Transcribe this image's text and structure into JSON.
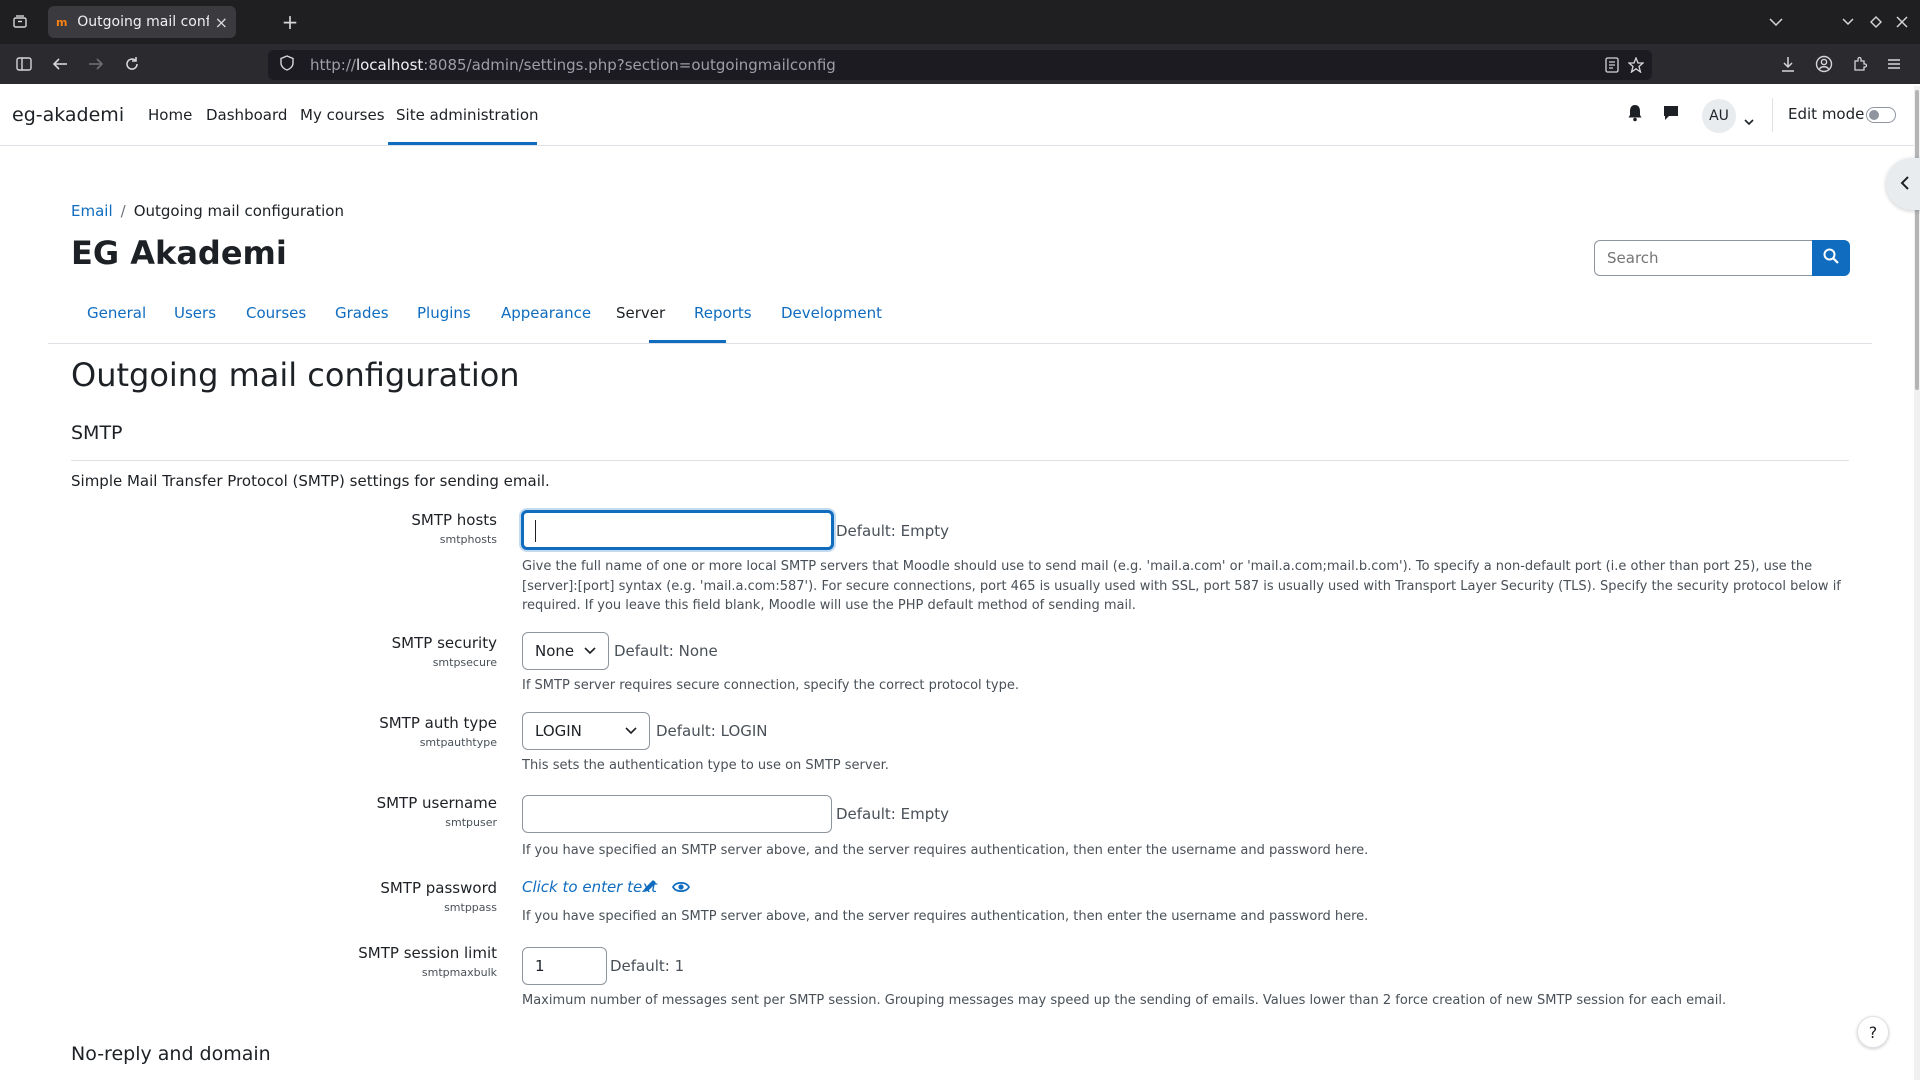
{
  "browser": {
    "tab_title": "Outgoing mail configuration",
    "tab_favicon": "m",
    "url_prefix": "http://",
    "url_host": "localhost",
    "url_rest": ":8085/admin/settings.php?section=outgoingmailconfig"
  },
  "navbar": {
    "brand": "eg-akademi",
    "links": [
      "Home",
      "Dashboard",
      "My courses",
      "Site administration"
    ],
    "active_link": "Site administration",
    "avatar_initials": "AU",
    "edit_mode_label": "Edit mode",
    "edit_mode_on": false
  },
  "breadcrumb": {
    "items": [
      "Email",
      "Outgoing mail configuration"
    ]
  },
  "site_title": "EG Akademi",
  "search": {
    "placeholder": "Search"
  },
  "admin_tabs": {
    "items": [
      "General",
      "Users",
      "Courses",
      "Grades",
      "Plugins",
      "Appearance",
      "Server",
      "Reports",
      "Development"
    ],
    "active": "Server"
  },
  "page": {
    "heading": "Outgoing mail configuration",
    "section_heading": "SMTP",
    "section_desc": "Simple Mail Transfer Protocol (SMTP) settings for sending email.",
    "next_section": "No-reply and domain"
  },
  "settings": {
    "smtphosts": {
      "label": "SMTP hosts",
      "name": "smtphosts",
      "value": "",
      "default": "Default: Empty",
      "help": "Give the full name of one or more local SMTP servers that Moodle should use to send mail (e.g. 'mail.a.com' or 'mail.a.com;mail.b.com'). To specify a non-default port (i.e other than port 25), use the [server]:[port] syntax (e.g. 'mail.a.com:587'). For secure connections, port 465 is usually used with SSL, port 587 is usually used with Transport Layer Security (TLS). Specify the security protocol below if required. If you leave this field blank, Moodle will use the PHP default method of sending mail."
    },
    "smtpsecure": {
      "label": "SMTP security",
      "name": "smtpsecure",
      "value": "None",
      "default": "Default: None",
      "help": "If SMTP server requires secure connection, specify the correct protocol type."
    },
    "smtpauthtype": {
      "label": "SMTP auth type",
      "name": "smtpauthtype",
      "value": "LOGIN",
      "default": "Default: LOGIN",
      "help": "This sets the authentication type to use on SMTP server."
    },
    "smtpuser": {
      "label": "SMTP username",
      "name": "smtpuser",
      "value": "",
      "default": "Default: Empty",
      "help": "If you have specified an SMTP server above, and the server requires authentication, then enter the username and password here."
    },
    "smtppass": {
      "label": "SMTP password",
      "name": "smtppass",
      "link": "Click to enter text",
      "help": "If you have specified an SMTP server above, and the server requires authentication, then enter the username and password here."
    },
    "smtpmaxbulk": {
      "label": "SMTP session limit",
      "name": "smtpmaxbulk",
      "value": "1",
      "default": "Default: 1",
      "help": "Maximum number of messages sent per SMTP session. Grouping messages may speed up the sending of emails. Values lower than 2 force creation of new SMTP session for each email."
    }
  },
  "help_button": "?",
  "colors": {
    "primary": "#0f6cbf",
    "text": "#1d2125",
    "muted": "#495057",
    "border": "#8f959e"
  }
}
